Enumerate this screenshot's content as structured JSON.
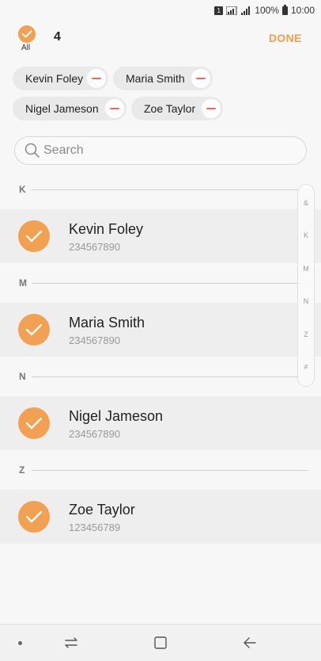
{
  "status_bar": {
    "sim": "1",
    "battery_percent": "100%",
    "time": "10:00"
  },
  "header": {
    "all_label": "All",
    "selected_count": "4",
    "done_label": "DONE"
  },
  "chips": [
    {
      "name": "Kevin Foley"
    },
    {
      "name": "Maria Smith"
    },
    {
      "name": "Nigel Jameson"
    },
    {
      "name": "Zoe Taylor"
    }
  ],
  "search": {
    "placeholder": "Search",
    "value": ""
  },
  "sections": [
    {
      "letter": "K",
      "contacts": [
        {
          "name": "Kevin Foley",
          "phone": "234567890",
          "checked": true
        }
      ]
    },
    {
      "letter": "M",
      "contacts": [
        {
          "name": "Maria Smith",
          "phone": "234567890",
          "checked": true
        }
      ]
    },
    {
      "letter": "N",
      "contacts": [
        {
          "name": "Nigel Jameson",
          "phone": "234567890",
          "checked": true
        }
      ]
    },
    {
      "letter": "Z",
      "contacts": [
        {
          "name": "Zoe Taylor",
          "phone": "123456789",
          "checked": true
        }
      ]
    }
  ],
  "index_letters": [
    "&",
    "K",
    "M",
    "N",
    "Z",
    "#"
  ],
  "nav": {
    "icons": [
      "dot-icon",
      "recents-icon",
      "home-icon",
      "back-icon"
    ]
  },
  "colors": {
    "accent": "#f2a051",
    "done": "#f0a04a",
    "remove": "#e56b5e",
    "row_bg": "#eeeeee",
    "page_bg": "#f7f7f7"
  }
}
